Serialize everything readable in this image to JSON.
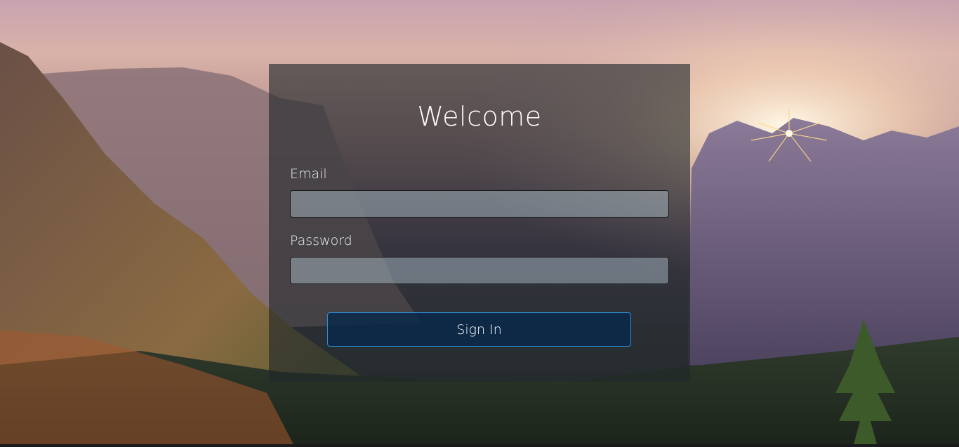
{
  "login": {
    "title": "Welcome",
    "email_label": "Email",
    "email_value": "",
    "password_label": "Password",
    "password_value": "",
    "sign_in_label": "Sign In"
  },
  "colors": {
    "accent_border": "#2a8fd6",
    "button_bg": "#08284b"
  }
}
